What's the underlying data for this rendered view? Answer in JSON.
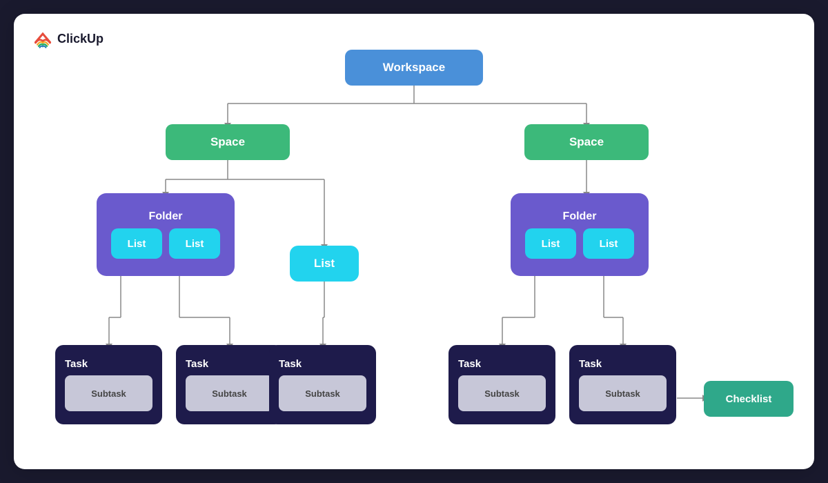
{
  "app": {
    "name": "ClickUp"
  },
  "diagram": {
    "workspace_label": "Workspace",
    "space_left_label": "Space",
    "space_right_label": "Space",
    "folder_left_label": "Folder",
    "folder_right_label": "Folder",
    "list_label": "List",
    "task_label": "Task",
    "subtask_label": "Subtask",
    "checklist_label": "Checklist"
  },
  "colors": {
    "workspace": "#4a90d9",
    "space": "#3cb97a",
    "folder": "#6a5acd",
    "list": "#22d3ee",
    "task": "#1e1b4b",
    "subtask": "#c7c7d8",
    "checklist": "#2fa88a",
    "line": "#555566"
  }
}
